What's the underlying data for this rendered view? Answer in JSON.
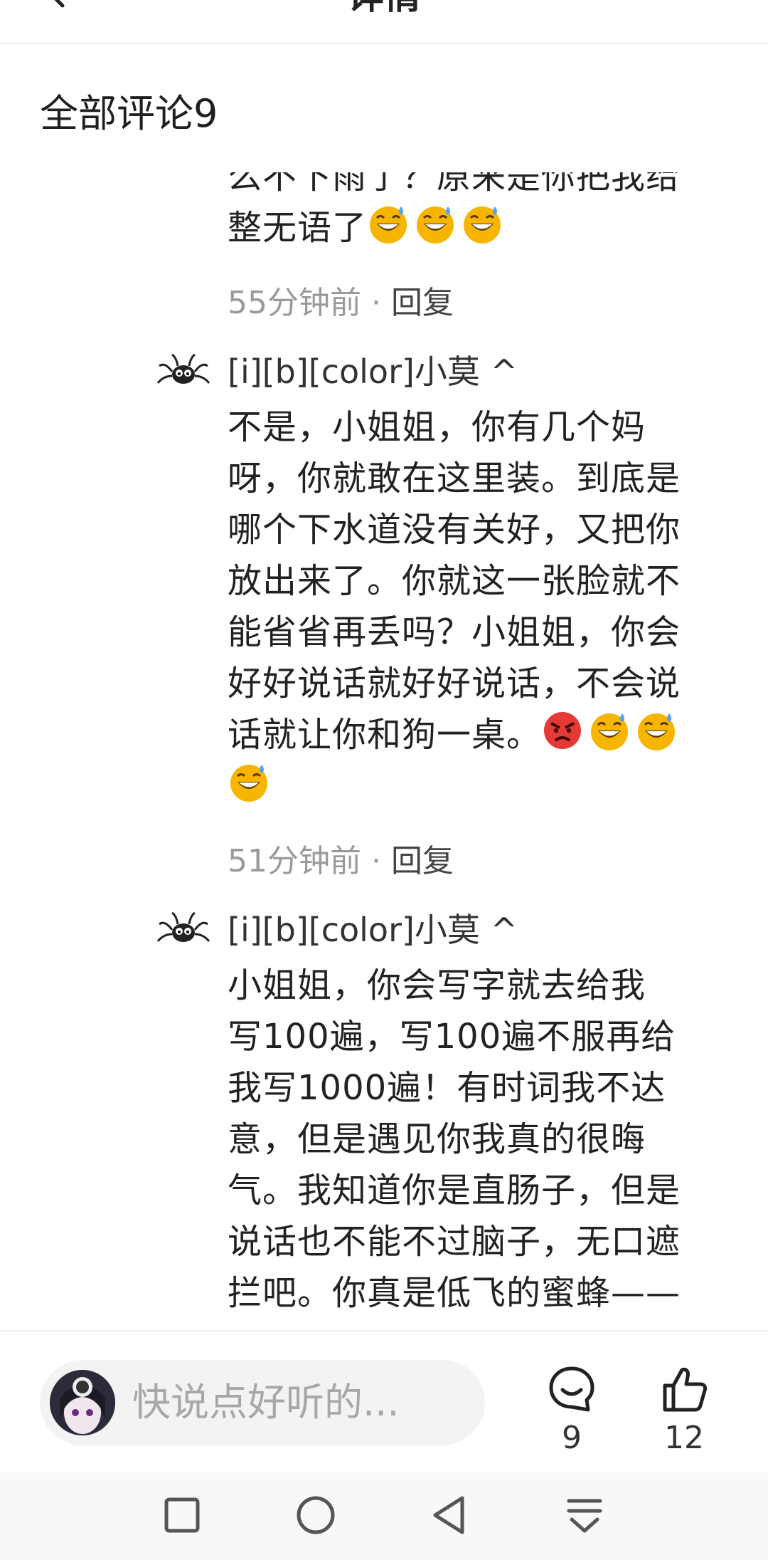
{
  "header": {
    "title": "详情"
  },
  "comments_section": {
    "title": "全部评论9"
  },
  "comments": [
    {
      "partial_top": true,
      "text_line1": "么不下雨了？原来是你把我给",
      "text_line2": "整无语了",
      "emojis": [
        "sweat-smile",
        "sweat-smile",
        "sweat-smile"
      ],
      "time": "55分钟前",
      "separator": "·",
      "reply_label": "回复"
    },
    {
      "author": "[i][b][color]小莫 ^",
      "text": "不是，小姐姐，你有几个妈\n呀，你就敢在这里装。到底是\n哪个下水道没有关好，又把你\n放出来了。你就这一张脸就不\n能省省再丢吗？小姐姐，你会\n好好说话就好好说话，不会说\n话就让你和狗一桌。",
      "emojis": [
        "angry",
        "sweat-smile",
        "sweat-smile",
        "sweat-smile"
      ],
      "time": "51分钟前",
      "separator": "·",
      "reply_label": "回复"
    },
    {
      "author": "[i][b][color]小莫 ^",
      "text": "小姐姐，你会写字就去给我\n写100遍，写100遍不服再给\n我写1000遍！有时词我不达\n意，但是遇见你我真的很晦\n气。我知道你是直肠子，但是\n说话也不能不过脑子，无口遮\n拦吧。你真是低飞的蜜蜂——"
    }
  ],
  "bottom_bar": {
    "input_placeholder": "快说点好听的...",
    "comment_count": "9",
    "like_count": "12"
  },
  "colors": {
    "text": "#222222",
    "muted": "#9a9a9a",
    "input_bg": "#f3f3f3",
    "emoji_yellow": "#f7b500",
    "emoji_red": "#e53935"
  }
}
